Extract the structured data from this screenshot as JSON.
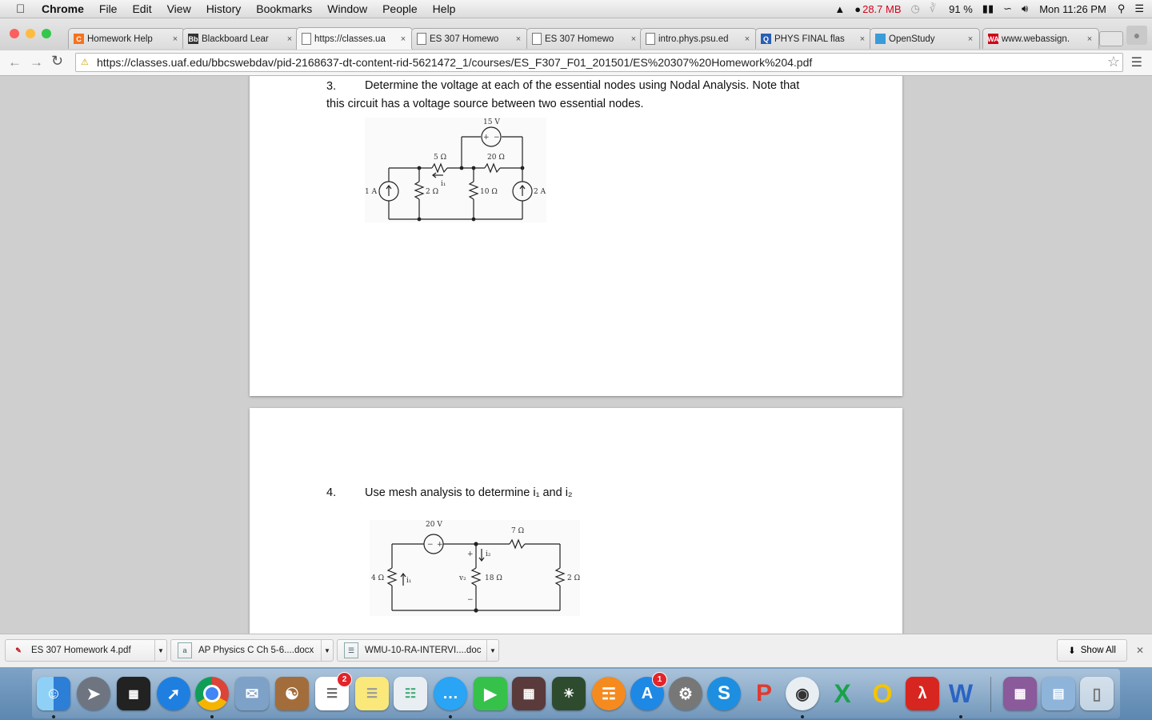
{
  "menubar": {
    "app": "Chrome",
    "menus": [
      "File",
      "Edit",
      "View",
      "History",
      "Bookmarks",
      "Window",
      "People",
      "Help"
    ],
    "memory": "28.7 MB",
    "battery": "91 %",
    "clock": "Mon 11:26 PM"
  },
  "tabs": [
    {
      "title": "Homework Help",
      "icon": "chegg-icon",
      "fav": "C",
      "fav_color": "#f47321"
    },
    {
      "title": "Blackboard Lear",
      "icon": "blackboard-icon",
      "fav": "Bb",
      "fav_color": "#333333"
    },
    {
      "title": "https://classes.ua",
      "icon": "document-icon",
      "fav": "",
      "fav_color": "#ffffff",
      "active": true
    },
    {
      "title": "ES 307 Homewo",
      "icon": "document-icon",
      "fav": "",
      "fav_color": "#ffffff"
    },
    {
      "title": "ES 307 Homewo",
      "icon": "document-icon",
      "fav": "",
      "fav_color": "#ffffff"
    },
    {
      "title": "intro.phys.psu.ed",
      "icon": "document-icon",
      "fav": "",
      "fav_color": "#ffffff"
    },
    {
      "title": "PHYS FINAL flas",
      "icon": "quizlet-icon",
      "fav": "Q",
      "fav_color": "#2a5eb5"
    },
    {
      "title": "OpenStudy",
      "icon": "openstudy-icon",
      "fav": "",
      "fav_color": "#3a9bd9"
    },
    {
      "title": "www.webassign.",
      "icon": "webassign-icon",
      "fav": "WA",
      "fav_color": "#d0021b"
    }
  ],
  "address": {
    "url": "https://classes.uaf.edu/bbcswebdav/pid-2168637-dt-content-rid-5621472_1/courses/ES_F307_F01_201501/ES%20307%20Homework%204.pdf"
  },
  "document": {
    "q3_number": "3.",
    "q3_line1": "Determine the voltage at each of the essential nodes using Nodal Analysis.  Note that",
    "q3_line2": "this circuit has a voltage source between two essential nodes.",
    "q4_number": "4.",
    "q4_text": "Use mesh analysis to determine i₁ and i₂",
    "circuit1": {
      "source_v": "15 V",
      "r1": "5 Ω",
      "r2": "20 Ω",
      "current_label": "i₁",
      "src_left": "1 A",
      "r3": "2 Ω",
      "r4": "10 Ω",
      "src_right": "2 A",
      "plus": "+",
      "minus": "−"
    },
    "circuit2": {
      "source_v": "20 V",
      "r_top": "7 Ω",
      "r_left": "4 Ω",
      "r_mid": "18 Ω",
      "r_right": "2 Ω",
      "i1": "i₁",
      "i2": "i₂",
      "v2": "v₂",
      "plus": "+",
      "minus": "−"
    }
  },
  "downloads": {
    "items": [
      {
        "name": "ES 307 Homework 4.pdf",
        "icon": "pdf-icon"
      },
      {
        "name": "AP Physics C Ch 5-6....docx",
        "icon": "docx-icon"
      },
      {
        "name": "WMU-10-RA-INTERVI....doc",
        "icon": "doc-icon"
      }
    ],
    "show_all": "Show All"
  },
  "dock": {
    "badges": {
      "reminders": "2",
      "appstore": "1"
    }
  },
  "colors": {
    "accent": "#3b73b9",
    "viewer_bg": "#cfcfcf"
  }
}
